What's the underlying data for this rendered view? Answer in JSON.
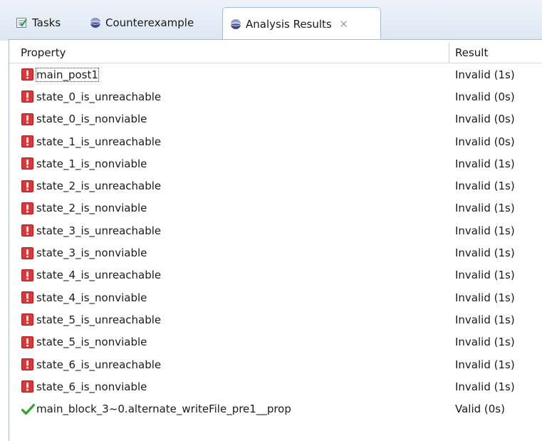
{
  "tabs": [
    {
      "label": "Tasks",
      "icon": "tasks-icon",
      "active": false
    },
    {
      "label": "Counterexample",
      "icon": "counterexample-icon",
      "active": false
    },
    {
      "label": "Analysis Results",
      "icon": "analysis-results-icon",
      "active": true,
      "close_icon": "close-icon"
    }
  ],
  "table": {
    "columns": [
      "Property",
      "Result"
    ],
    "rows": [
      {
        "property": "main_post1",
        "result": "Invalid (1s)",
        "status": "invalid",
        "selected": true
      },
      {
        "property": "state_0_is_unreachable",
        "result": "Invalid (0s)",
        "status": "invalid"
      },
      {
        "property": "state_0_is_nonviable",
        "result": "Invalid (0s)",
        "status": "invalid"
      },
      {
        "property": "state_1_is_unreachable",
        "result": "Invalid (0s)",
        "status": "invalid"
      },
      {
        "property": "state_1_is_nonviable",
        "result": "Invalid (1s)",
        "status": "invalid"
      },
      {
        "property": "state_2_is_unreachable",
        "result": "Invalid (1s)",
        "status": "invalid"
      },
      {
        "property": "state_2_is_nonviable",
        "result": "Invalid (1s)",
        "status": "invalid"
      },
      {
        "property": "state_3_is_unreachable",
        "result": "Invalid (1s)",
        "status": "invalid"
      },
      {
        "property": "state_3_is_nonviable",
        "result": "Invalid (1s)",
        "status": "invalid"
      },
      {
        "property": "state_4_is_unreachable",
        "result": "Invalid (1s)",
        "status": "invalid"
      },
      {
        "property": "state_4_is_nonviable",
        "result": "Invalid (1s)",
        "status": "invalid"
      },
      {
        "property": "state_5_is_unreachable",
        "result": "Invalid (1s)",
        "status": "invalid"
      },
      {
        "property": "state_5_is_nonviable",
        "result": "Invalid (1s)",
        "status": "invalid"
      },
      {
        "property": "state_6_is_unreachable",
        "result": "Invalid (1s)",
        "status": "invalid"
      },
      {
        "property": "state_6_is_nonviable",
        "result": "Invalid (1s)",
        "status": "invalid"
      },
      {
        "property": "main_block_3~0.alternate_writeFile_pre1__prop",
        "result": "Valid (0s)",
        "status": "valid"
      }
    ]
  },
  "colors": {
    "invalid": "#d9383a",
    "valid": "#2fa52a",
    "tab_border": "#a9b9cf"
  }
}
